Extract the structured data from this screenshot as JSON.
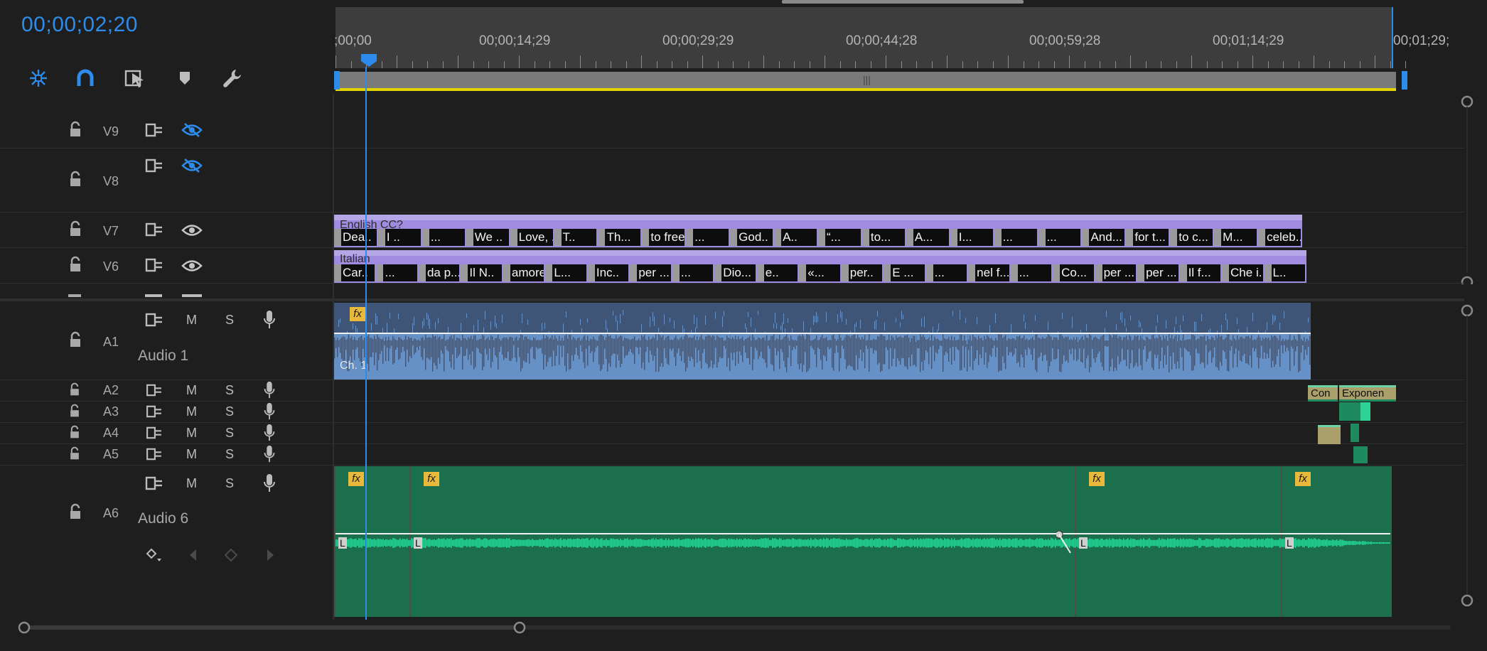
{
  "playhead_timecode": "00;00;02;20",
  "ruler": {
    "timecodes": [
      ";00;00",
      "00;00;14;29",
      "00;00;29;29",
      "00;00;44;28",
      "00;00;59;28",
      "00;01;14;29",
      "00;01;29;"
    ]
  },
  "toolbar": {
    "icons": [
      "snap-nest-icon",
      "magnet-snap-icon",
      "linked-selection-icon",
      "add-marker-icon",
      "wrench-settings-icon"
    ]
  },
  "zoombar": {
    "handle_label": "|||"
  },
  "video_tracks": [
    {
      "id": "V9",
      "eye": "hidden"
    },
    {
      "id": "V8",
      "eye": "hidden"
    },
    {
      "id": "V7",
      "eye": "visible"
    },
    {
      "id": "V6",
      "eye": "visible"
    }
  ],
  "audio_tracks": [
    {
      "id": "A1",
      "name": "Audio 1",
      "m": "M",
      "s": "S"
    },
    {
      "id": "A2",
      "m": "M",
      "s": "S"
    },
    {
      "id": "A3",
      "m": "M",
      "s": "S"
    },
    {
      "id": "A4",
      "m": "M",
      "s": "S"
    },
    {
      "id": "A5",
      "m": "M",
      "s": "S"
    },
    {
      "id": "A6",
      "name": "Audio 6",
      "m": "M",
      "s": "S"
    }
  ],
  "clips": {
    "v7_title": "English CC?",
    "v7_segments": [
      "Dea..",
      "I ..",
      "...",
      "We ..",
      "Love, ...",
      "T..",
      "Th...",
      "to free ...",
      "...",
      "God..",
      "A..",
      "“...",
      "to...",
      "A...",
      "I...",
      "...",
      "...",
      "And...",
      "for t...",
      "to c...",
      "M...",
      "celeb..."
    ],
    "v6_title": "Italian",
    "v6_segments": [
      "Car..",
      "...",
      "da p...",
      "Il N..",
      "amore, ...",
      "L...",
      "Inc..",
      "per ...",
      "...",
      "Dio...",
      "e..",
      "«...",
      "per..",
      "E ...",
      "...",
      "nel f...",
      "...",
      "Co...",
      "per ...",
      "per ...",
      "Il f...",
      "Che i..",
      "L.."
    ],
    "a1_channel": "Ch. 1",
    "fx_label": "fx",
    "a2_clip_1": "Con",
    "a2_clip_2": "Exponen",
    "a6_keyframe_label": "L"
  },
  "colors": {
    "accent": "#2d8ceb",
    "video_clip": "#9f8ce0",
    "audio1_clip": "#6691c6",
    "audio6_clip": "#1b6f4d",
    "audio6_wave": "#2ed196",
    "work_area": "#e3d400"
  }
}
